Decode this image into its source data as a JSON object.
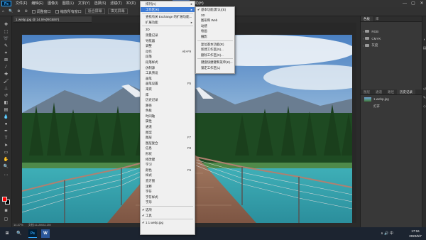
{
  "menubar": {
    "logo": "Ps",
    "items": [
      {
        "label": "文件(F)"
      },
      {
        "label": "编辑(E)"
      },
      {
        "label": "图像(I)"
      },
      {
        "label": "图层(L)"
      },
      {
        "label": "文字(Y)"
      },
      {
        "label": "选择(S)"
      },
      {
        "label": "滤镜(T)"
      },
      {
        "label": "3D(D)"
      },
      {
        "label": "视图(V)"
      },
      {
        "label": "增效工具"
      },
      {
        "label": "窗口(W)"
      },
      {
        "label": "帮助(H)"
      }
    ],
    "window_controls": [
      "—",
      "▢",
      "✕"
    ]
  },
  "optionsbar": {
    "label_zoom": "缩放",
    "sample": "调整窗口",
    "fit_screen": "填充屏幕",
    "all_windows": "缩放所有窗口",
    "fit_btn": "适合屏幕",
    "fill_btn": "填充屏幕"
  },
  "document": {
    "tab_title": "1.webp.jpg @ 14.5%(RGB/8*)",
    "zoom": "14.47%",
    "info": "文档:11.2M/11.2M"
  },
  "window_menu": {
    "items": [
      {
        "label": "排列(A)",
        "arrow": true
      },
      {
        "label": "工作区(K)",
        "arrow": true,
        "highlight": true
      },
      {
        "sep": true
      },
      {
        "label": "查找有关 Exchange 的扩展功能..."
      },
      {
        "label": "扩展功能",
        "arrow": true
      },
      {
        "sep": true
      },
      {
        "label": "3D"
      },
      {
        "label": "测量记录"
      },
      {
        "label": "导航器"
      },
      {
        "label": "调整"
      },
      {
        "label": "动作",
        "shortcut": "Alt+F9"
      },
      {
        "label": "段落"
      },
      {
        "label": "段落样式"
      },
      {
        "label": "仿制源"
      },
      {
        "label": "工具预设"
      },
      {
        "label": "画笔"
      },
      {
        "label": "画笔设置",
        "shortcut": "F5"
      },
      {
        "label": "来宾"
      },
      {
        "label": "库"
      },
      {
        "label": "历史记录"
      },
      {
        "label": "路径"
      },
      {
        "label": "色板"
      },
      {
        "label": "时间轴"
      },
      {
        "label": "属性"
      },
      {
        "label": "通道"
      },
      {
        "label": "图案"
      },
      {
        "label": "图层",
        "shortcut": "F7"
      },
      {
        "label": "图层复合"
      },
      {
        "label": "信息",
        "shortcut": "F8"
      },
      {
        "label": "形状"
      },
      {
        "label": "修改键"
      },
      {
        "label": "学习"
      },
      {
        "label": "颜色",
        "shortcut": "F6"
      },
      {
        "label": "样式"
      },
      {
        "label": "直方图"
      },
      {
        "label": "注释"
      },
      {
        "label": "字符"
      },
      {
        "label": "字符样式"
      },
      {
        "label": "字形"
      },
      {
        "sep": true
      },
      {
        "label": "选项",
        "check": true
      },
      {
        "label": "工具",
        "check": true
      },
      {
        "sep": true
      },
      {
        "label": "1 1.webp.jpg",
        "check": true
      }
    ]
  },
  "workspace_menu": {
    "items": [
      {
        "label": "基本功能(默认)(E)",
        "check": true
      },
      {
        "label": "3D"
      },
      {
        "label": "图形和 Web"
      },
      {
        "label": "动感"
      },
      {
        "label": "绘画"
      },
      {
        "label": "摄影"
      },
      {
        "sep": true
      },
      {
        "label": "复位基本功能(R)"
      },
      {
        "label": "新建工作区(N)..."
      },
      {
        "label": "删除工作区(D)..."
      },
      {
        "sep": true
      },
      {
        "label": "键盘快捷键和菜单(K)..."
      },
      {
        "label": "锁定工作区(L)"
      }
    ]
  },
  "panels": {
    "top_tabs": [
      "色板",
      "库"
    ],
    "swatch_groups": [
      "RGB",
      "CMYK",
      "灰度"
    ],
    "mid_tabs": [
      "图层",
      "通道",
      "路径",
      "历史记录"
    ],
    "history_snapshot": "1.webp.jpg",
    "history_state": "打开"
  },
  "taskbar": {
    "start": "⊞",
    "search": "🔍",
    "ps": "Ps",
    "word": "W",
    "tray": "∧ 🔊 中",
    "time": "17:16",
    "date": "2022/5/7"
  },
  "colors": {
    "accent": "#3c7bd6",
    "foreground_swatch": "#ff0000",
    "background_swatch": "#000000"
  }
}
